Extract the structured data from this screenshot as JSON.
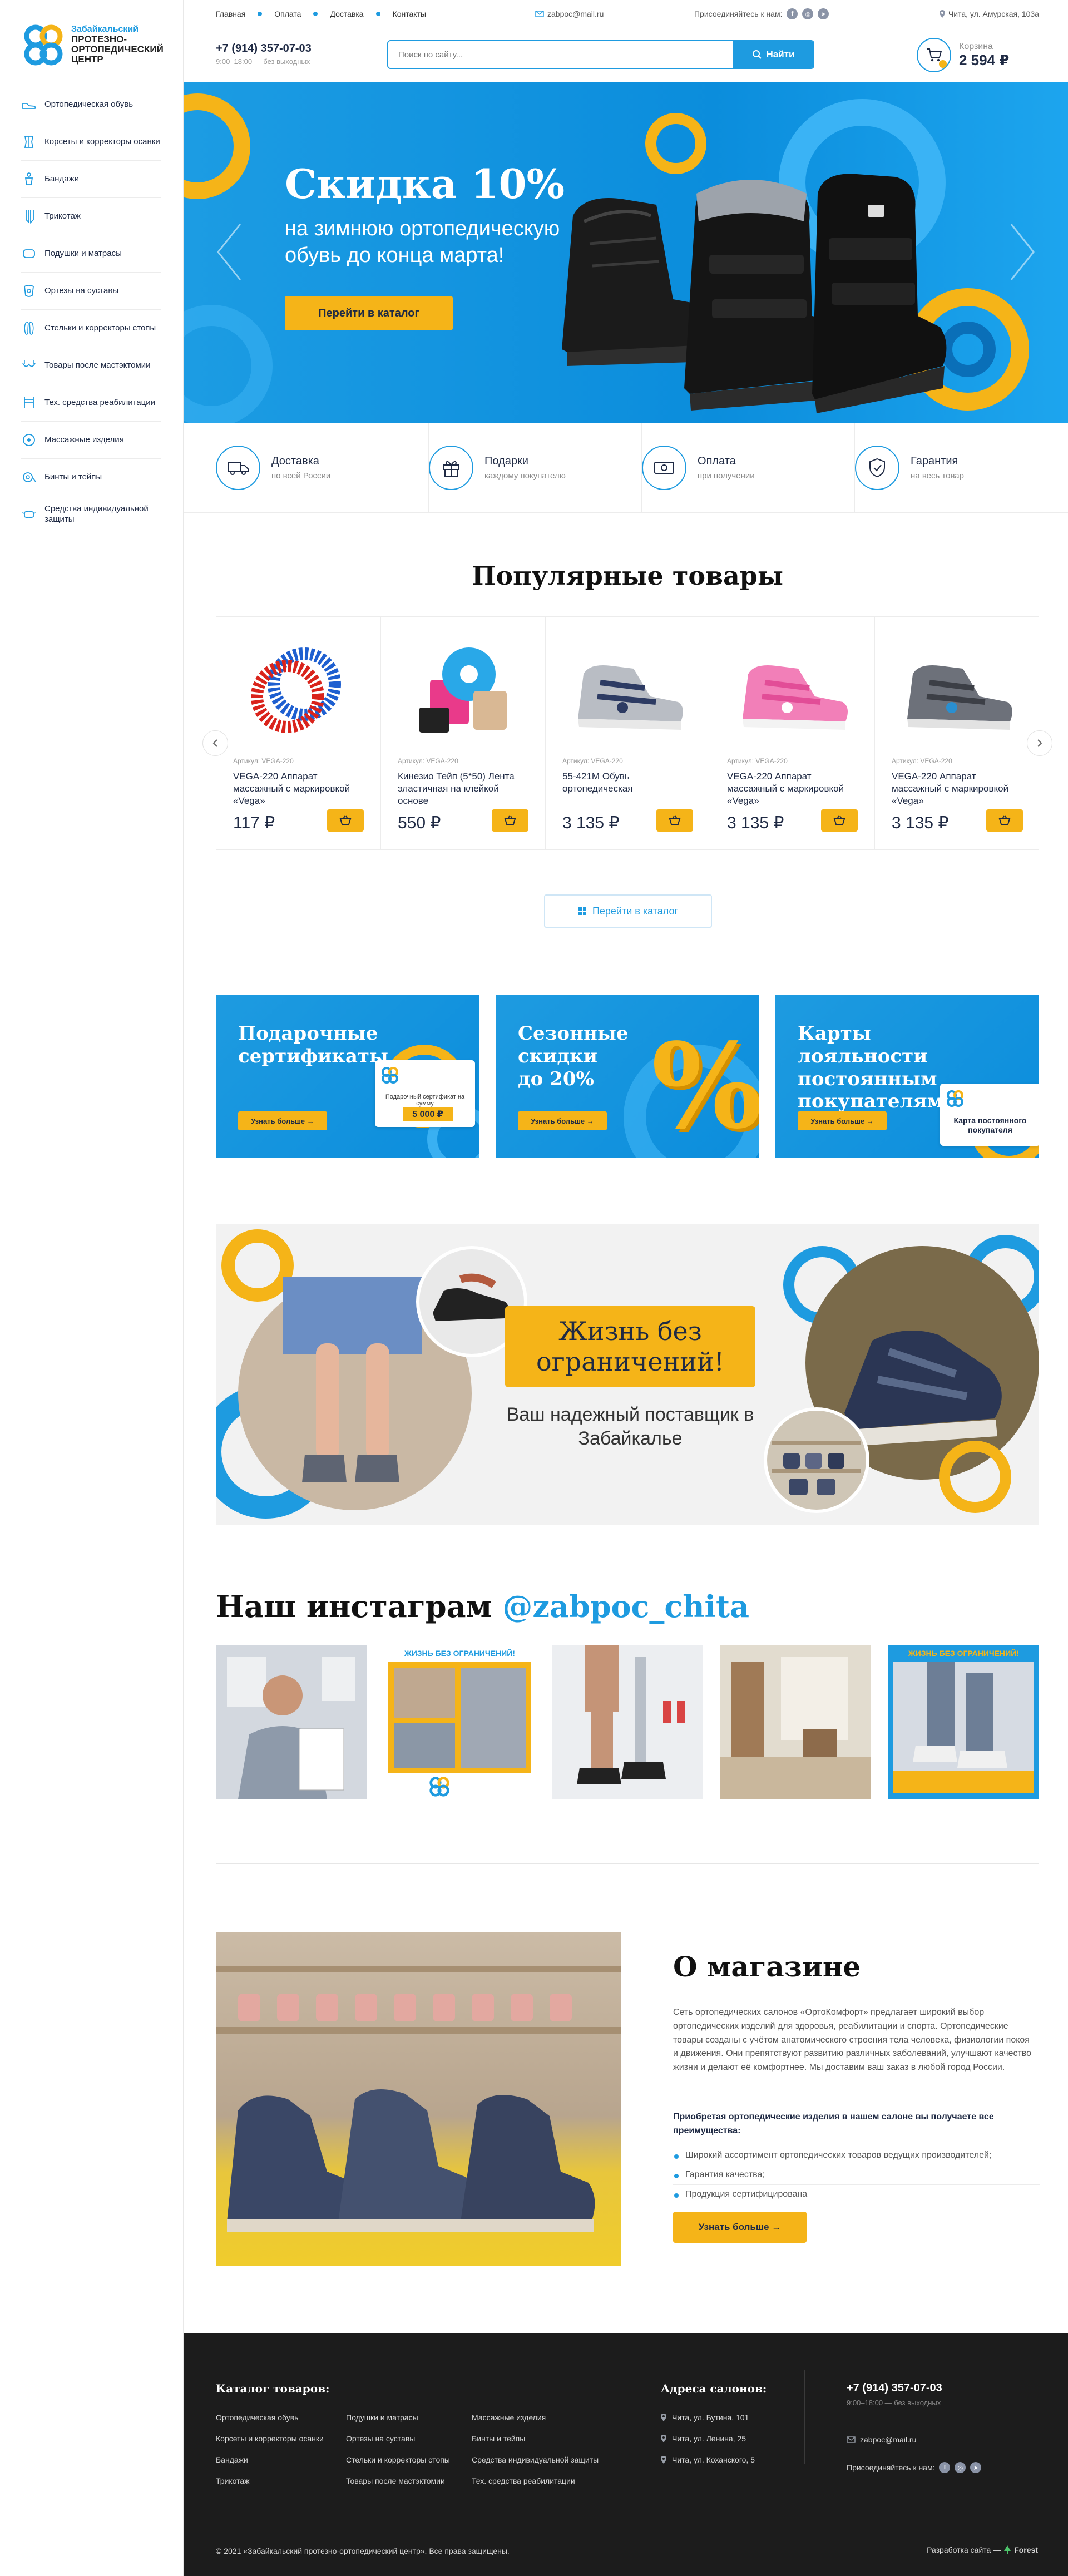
{
  "brand": {
    "line1": "Забайкальский",
    "line2": "протезно-",
    "line3": "ортопедический",
    "line4": "центр",
    "colors": {
      "blue": "#1e9be0",
      "yellow": "#f5b418",
      "dark": "#1c1c1c"
    }
  },
  "sidebar": {
    "items": [
      {
        "label": "Ортопедическая обувь",
        "icon": "shoe-icon"
      },
      {
        "label": "Корсеты и корректоры осанки",
        "icon": "corset-icon"
      },
      {
        "label": "Бандажи",
        "icon": "bandage-icon"
      },
      {
        "label": "Трикотаж",
        "icon": "stocking-icon"
      },
      {
        "label": "Подушки и матрасы",
        "icon": "pillow-icon"
      },
      {
        "label": "Ортезы на суставы",
        "icon": "orthosis-icon"
      },
      {
        "label": "Стельки и корректоры стопы",
        "icon": "insole-icon"
      },
      {
        "label": "Товары после мастэктомии",
        "icon": "bra-icon"
      },
      {
        "label": "Тех. средства реабилитации",
        "icon": "walker-icon"
      },
      {
        "label": "Массажные изделия",
        "icon": "massage-ball-icon"
      },
      {
        "label": "Бинты и тейпы",
        "icon": "tape-icon"
      },
      {
        "label": "Средства индивидуальной защиты",
        "icon": "mask-icon"
      }
    ]
  },
  "topbar": {
    "nav": [
      "Главная",
      "Оплата",
      "Доставка",
      "Контакты"
    ],
    "email": "zabpoc@mail.ru",
    "join": "Присоединяйтесь к нам:",
    "address": "Чита, ул. Амурская, 103а"
  },
  "header": {
    "phone": "+7 (914) 357-07-03",
    "hours": "9:00–18:00 — без выходных",
    "search_placeholder": "Поиск по сайту...",
    "search_button": "Найти",
    "cart_label": "Корзина",
    "cart_sum": "2 594 ₽"
  },
  "hero": {
    "title": "Скидка 10%",
    "subtitle": "на зимнюю ортопедическую обувь до конца марта!",
    "button": "Перейти в каталог"
  },
  "features": [
    {
      "title": "Доставка",
      "sub": "по всей России",
      "icon": "truck-icon"
    },
    {
      "title": "Подарки",
      "sub": "каждому покупателю",
      "icon": "gift-icon"
    },
    {
      "title": "Оплата",
      "sub": "при получении",
      "icon": "money-icon"
    },
    {
      "title": "Гарантия",
      "sub": "на весь товар",
      "icon": "shield-icon"
    }
  ],
  "popular": {
    "title": "Популярные товары",
    "catalog_button": "Перейти в каталог",
    "products": [
      {
        "art": "Артикул: VEGA-220",
        "name": "VEGA-220 Аппарат массажный с маркировкой «Vega»",
        "price": "117 ₽",
        "kind": "rings"
      },
      {
        "art": "Артикул: VEGA-220",
        "name": "Кинезио Тейп (5*50) Лента эластичная на клейкой основе",
        "price": "550 ₽",
        "kind": "tape"
      },
      {
        "art": "Артикул: VEGA-220",
        "name": "55-421М Обувь ортопедическая",
        "price": "3 135 ₽",
        "kind": "sandal-grey"
      },
      {
        "art": "Артикул: VEGA-220",
        "name": "VEGA-220 Аппарат массажный с маркировкой «Vega»",
        "price": "3 135 ₽",
        "kind": "sandal-pink"
      },
      {
        "art": "Артикул: VEGA-220",
        "name": "VEGA-220 Аппарат массажный с маркировкой «Vega»",
        "price": "3 135 ₽",
        "kind": "sandal-dark"
      }
    ]
  },
  "promos": [
    {
      "title": "Подарочные сертификаты",
      "button": "Узнать больше →",
      "card_text": "Подарочный сертификат на сумму",
      "card_value": "5 000 ₽"
    },
    {
      "title": "Сезонные скидки до 20%",
      "button": "Узнать больше →",
      "badge": "%"
    },
    {
      "title": "Карты лояльности постоянным покупателям",
      "button": "Узнать больше →",
      "card_text": "Карта постоянного покупателя"
    }
  ],
  "banner": {
    "tag": "Жизнь без ограничений!",
    "sub": "Ваш надежный поставщик в Забайкалье"
  },
  "instagram": {
    "title": "Наш инстаграм",
    "handle": "@zabpoc_chita",
    "tile_label": "ЖИЗНЬ БЕЗ ОГРАНИЧЕНИЙ!"
  },
  "about": {
    "title": "О магазине",
    "text": "Сеть ортопедических салонов «ОртоКомфорт» предлагает широкий выбор ортопедических изделий для здоровья, реабилитации и спорта. Ортопедические товары созданы с учётом анатомического строения тела человека, физиологии покоя и движения. Они препятствуют развитию различных заболеваний, улучшают качество жизни и делают её комфортнее. Мы доставим ваш заказ в любой город России.",
    "bold": "Приобретая ортопедические изделия в нашем салоне вы получаете все преимущества:",
    "list": [
      "Широкий ассортимент ортопедических товаров ведущих производителей;",
      "Гарантия качества;",
      "Продукция сертифицирована"
    ],
    "button": "Узнать больше →"
  },
  "footer": {
    "catalog_title": "Каталог товаров:",
    "col1": [
      "Ортопедическая обувь",
      "Корсеты и корректоры осанки",
      "Бандажи",
      "Трикотаж"
    ],
    "col2": [
      "Подушки и матрасы",
      "Ортезы на суставы",
      "Стельки и корректоры стопы",
      "Товары после мастэктомии"
    ],
    "col3": [
      "Массажные изделия",
      "Бинты и тейпы",
      "Средства индивидуальной защиты",
      "Тех. средства реабилитации"
    ],
    "addr_title": "Адреса салонов:",
    "addresses": [
      "Чита, ул. Бутина, 101",
      "Чита, ул. Ленина, 25",
      "Чита, ул. Коханского, 5"
    ],
    "phone": "+7 (914) 357-07-03",
    "hours": "9:00–18:00 — без выходных",
    "email": "zabpoc@mail.ru",
    "join": "Присоединяйтесь к нам:",
    "copyright": "© 2021 «Забайкальский протезно-ортопедический центр». Все права защищены.",
    "dev_label": "Разработка сайта —",
    "dev_name": "Forest"
  }
}
